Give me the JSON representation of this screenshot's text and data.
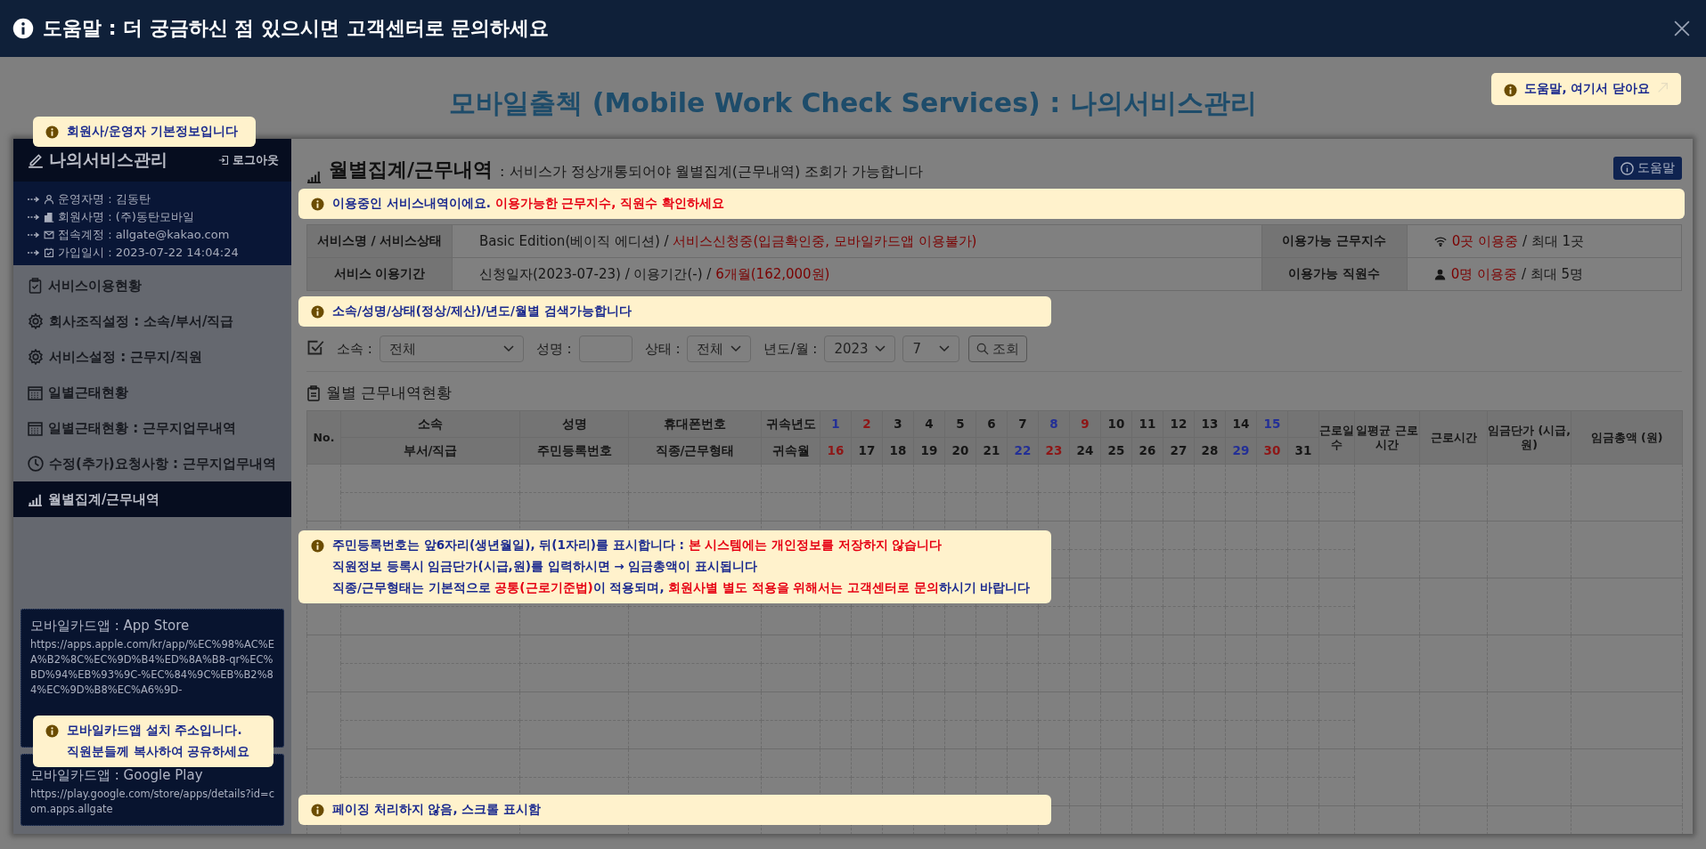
{
  "help_bar": {
    "title": "도움말 : 더 궁금하신 점 있으시면 고객센터로 문의하세요"
  },
  "page": {
    "title": "모바일출첵 (Mobile Work Check Services) : 나의서비스관리",
    "close_tip": "도움말, 여기서 닫아요"
  },
  "sidebar": {
    "title": "나의서비스관리",
    "logout": "로그아웃",
    "tip": "회원사/운영자 기본정보입니다",
    "info": [
      {
        "kind": "person",
        "text": "운영자명 : 김동탄"
      },
      {
        "kind": "building",
        "text": "회원사명 : (주)동탄모바일"
      },
      {
        "kind": "mail",
        "text": "접속계정 : allgate@kakao.com"
      },
      {
        "kind": "calendar",
        "text": "가입일시 : 2023-07-22 14:04:24"
      }
    ],
    "menu": [
      {
        "kind": "clipboard",
        "label": "서비스이용현황",
        "selected": false
      },
      {
        "kind": "gear",
        "label": "회사조직설정 : 소속/부서/직급",
        "selected": false
      },
      {
        "kind": "gear",
        "label": "서비스설정 : 근무지/직원",
        "selected": false
      },
      {
        "kind": "grid",
        "label": "일별근태현황",
        "selected": false
      },
      {
        "kind": "grid",
        "label": "일별근태현황 : 근무지업무내역",
        "selected": false
      },
      {
        "kind": "clock",
        "label": "수정(추가)요청사항 : 근무지업무내역",
        "selected": false
      },
      {
        "kind": "chart",
        "label": "월별집계/근무내역",
        "selected": true
      }
    ],
    "app_links": [
      {
        "title": "모바일카드앱 : App Store",
        "url": "https://apps.apple.com/kr/app/%EC%98%AC%EA%B2%8C%EC%9D%B4%ED%8A%B8-qr%EC%BD%94%EB%93%9C-%EC%84%9C%EB%B2%84%EC%9D%B8%EC%A6%9D-"
      },
      {
        "title": "모바일카드앱 : Google Play",
        "url": "https://play.google.com/store/apps/details?id=com.apps.allgate"
      }
    ],
    "app_tip": [
      "모바일카드앱 설치 주소입니다.",
      "직원분들께 복사하여 공유하세요"
    ]
  },
  "content": {
    "title": "월별집계/근무내역",
    "subtitle": ": 서비스가 정상개통되어야 월별집계(근무내역) 조회가 가능합니다",
    "help_button": "도움말",
    "service_tip": [
      [
        {
          "kind": "plain",
          "text": "이용중인 서비스내역이에요. "
        },
        {
          "kind": "alert",
          "text": "이용가능한 근무지수, 직원수 확인하세요"
        }
      ]
    ],
    "service_info": [
      {
        "label": "서비스명 / 서비스상태",
        "value": [
          {
            "kind": "plain",
            "text": "Basic Edition(베이직 에디션) / "
          },
          {
            "kind": "alert",
            "text": "서비스신청중(입금확인중, 모바일카드앱 이용불가)"
          }
        ],
        "label2": "이용가능 근무지수",
        "kind": "sites",
        "value2": [
          {
            "kind": "alert",
            "text": "0곳 이용중"
          },
          {
            "kind": "plain",
            "text": " / 최대 1곳"
          }
        ]
      },
      {
        "label": "서비스 이용기간",
        "value": [
          {
            "kind": "plain",
            "text": "신청일자(2023-07-23) / 이용기간(-) / "
          },
          {
            "kind": "alert",
            "text": "6개월(162,000원)"
          }
        ],
        "label2": "이용가능 직원수",
        "kind": "staff",
        "value2": [
          {
            "kind": "alert",
            "text": "0명 이용중"
          },
          {
            "kind": "plain",
            "text": " / 최대 5명"
          }
        ]
      }
    ],
    "search_tip": [
      "소속/성명/상태(정상/제산)/년도/월별 검색가능합니다"
    ],
    "filters": [
      {
        "kind": "select",
        "label": "소속 :",
        "value": "전체"
      },
      {
        "kind": "input",
        "label": "성명 :"
      },
      {
        "kind": "select",
        "label": "상태 :",
        "value": "전체"
      },
      {
        "kind": "select",
        "label": "년도/월 :",
        "value": "2023"
      },
      {
        "kind": "select",
        "value": "7"
      }
    ],
    "search_button": "조회",
    "section_title": "월별 근무내역현황",
    "table": {
      "no": "No.",
      "pairs": [
        {
          "top": "소속",
          "bottom": "부서/직급"
        },
        {
          "top": "성명",
          "bottom": "주민등록번호"
        },
        {
          "top": "휴대폰번호",
          "bottom": "직종/근무형태"
        },
        {
          "top": "귀속년도",
          "bottom": "귀속월"
        }
      ],
      "days_top": [
        {
          "label": "1",
          "kind": "saturday"
        },
        {
          "label": "2",
          "kind": "sunday"
        },
        {
          "label": "3",
          "kind": "weekday"
        },
        {
          "label": "4",
          "kind": "weekday"
        },
        {
          "label": "5",
          "kind": "weekday"
        },
        {
          "label": "6",
          "kind": "weekday"
        },
        {
          "label": "7",
          "kind": "weekday"
        },
        {
          "label": "8",
          "kind": "saturday"
        },
        {
          "label": "9",
          "kind": "sunday"
        },
        {
          "label": "10",
          "kind": "weekday"
        },
        {
          "label": "11",
          "kind": "weekday"
        },
        {
          "label": "12",
          "kind": "weekday"
        },
        {
          "label": "13",
          "kind": "weekday"
        },
        {
          "label": "14",
          "kind": "weekday"
        },
        {
          "label": "15",
          "kind": "saturday"
        }
      ],
      "days_bottom": [
        {
          "label": "16",
          "kind": "sunday"
        },
        {
          "label": "17",
          "kind": "weekday"
        },
        {
          "label": "18",
          "kind": "weekday"
        },
        {
          "label": "19",
          "kind": "weekday"
        },
        {
          "label": "20",
          "kind": "weekday"
        },
        {
          "label": "21",
          "kind": "weekday"
        },
        {
          "label": "22",
          "kind": "saturday"
        },
        {
          "label": "23",
          "kind": "sunday"
        },
        {
          "label": "24",
          "kind": "weekday"
        },
        {
          "label": "25",
          "kind": "weekday"
        },
        {
          "label": "26",
          "kind": "weekday"
        },
        {
          "label": "27",
          "kind": "weekday"
        },
        {
          "label": "28",
          "kind": "weekday"
        },
        {
          "label": "29",
          "kind": "saturday"
        },
        {
          "label": "30",
          "kind": "sunday"
        },
        {
          "label": "31",
          "kind": "weekday"
        }
      ],
      "summary": [
        "근로일수",
        "일평균 근로시간",
        "근로시간",
        "임금단가 (시급,원)",
        "임금총액 (원)"
      ]
    },
    "notice_tip": [
      [
        {
          "kind": "plain",
          "text": "주민등록번호는 앞6자리(생년월일), 뒤(1자리)를 표시합니다 : "
        },
        {
          "kind": "alert",
          "text": "본 시스템에는 개인정보를 저장하지 않습니다"
        }
      ],
      [
        {
          "kind": "plain",
          "text": "직원정보 등록시 임금단가(시급,원)를 입력하시면 → 임금총액이 표시됩니다"
        }
      ],
      [
        {
          "kind": "plain",
          "text": "직종/근무형태는 기본적으로 "
        },
        {
          "kind": "alert",
          "text": "공통(근로기준법)"
        },
        {
          "kind": "plain",
          "text": "이 적용되며, "
        },
        {
          "kind": "alert",
          "text": "회원사별 별도 적용을 위해서는 고객센터로 문의"
        },
        {
          "kind": "plain",
          "text": "하시기 바랍니다"
        }
      ]
    ],
    "paging_tip": [
      "페이징 처리하지 않음, 스크롤 표시함"
    ]
  }
}
